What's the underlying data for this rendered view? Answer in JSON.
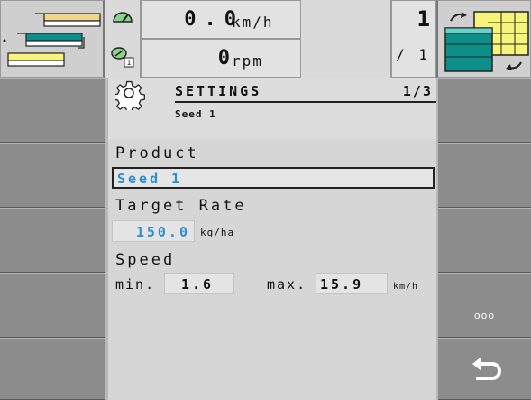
{
  "topbar": {
    "speed_value": "0.0",
    "speed_unit": "km/h",
    "rpm_value": "0",
    "rpm_unit": "rpm",
    "page_value": "1",
    "page_total": "/ 1",
    "speedometer_icon": "speedometer-icon",
    "rpm_icon": "rpm-gauge-icon"
  },
  "panel": {
    "title": "SETTINGS",
    "subtitle": "Seed 1",
    "page_indicator": "1/3",
    "product_label": "Product",
    "product_value": "Seed 1",
    "target_rate_label": "Target Rate",
    "target_rate_value": "150.0",
    "target_rate_unit": "kg/ha",
    "speed_label": "Speed",
    "min_label": "min.",
    "min_value": "1.6",
    "max_label": "max.",
    "max_value": "15.9",
    "speed_unit": "km/h"
  },
  "softkeys_right": {
    "more_label": "ooo"
  },
  "colors": {
    "accent_blue": "#2a8fd0",
    "teal": "#0e8e88",
    "yellow": "#f7f47a",
    "panel_grey": "#d6d6d6",
    "softkey_grey": "#8c8c8c"
  }
}
